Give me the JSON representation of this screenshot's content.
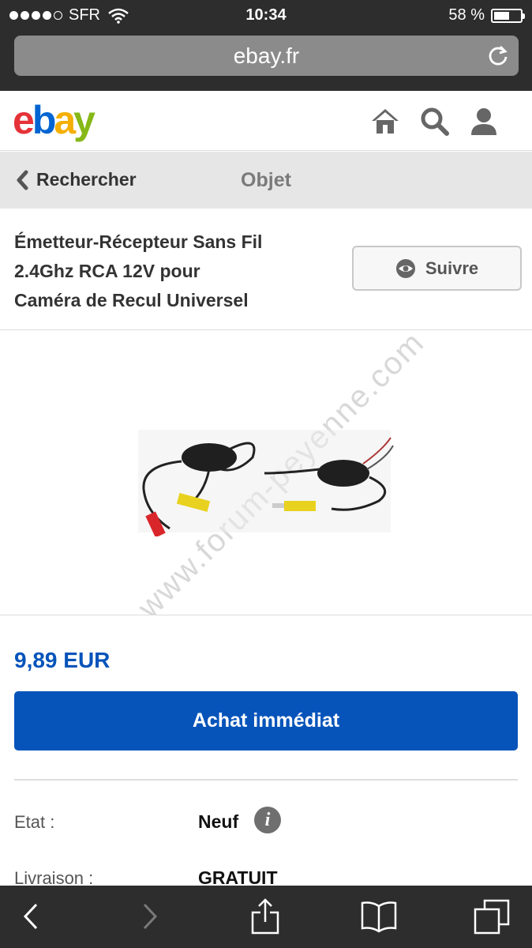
{
  "status_bar": {
    "carrier": "SFR",
    "time": "10:34",
    "battery_percent": "58 %",
    "battery_level": 0.58
  },
  "browser": {
    "url": "ebay.fr"
  },
  "header": {
    "logo_letters": [
      "e",
      "b",
      "a",
      "y"
    ],
    "icons": [
      "home-icon",
      "search-icon",
      "user-icon"
    ]
  },
  "nav": {
    "back_label": "Rechercher",
    "title": "Objet"
  },
  "item": {
    "title_lines": [
      "Émetteur-Récepteur Sans Fil",
      "2.4Ghz RCA 12V pour",
      "Caméra de Recul Universel"
    ],
    "follow_label": "Suivre",
    "image_watermark": "www.forum-peyenne.com",
    "price": "9,89 EUR",
    "buy_label": "Achat immédiat",
    "specs": [
      {
        "label": "Etat :",
        "value": "Neuf"
      },
      {
        "label": "Livraison :",
        "value": "GRATUIT"
      }
    ]
  },
  "toolbar": {
    "icons": [
      "back-icon",
      "forward-icon",
      "share-icon",
      "bookmarks-icon",
      "tabs-icon"
    ]
  },
  "colors": {
    "primary": "#0654ba",
    "chrome": "#2d2d2d"
  }
}
